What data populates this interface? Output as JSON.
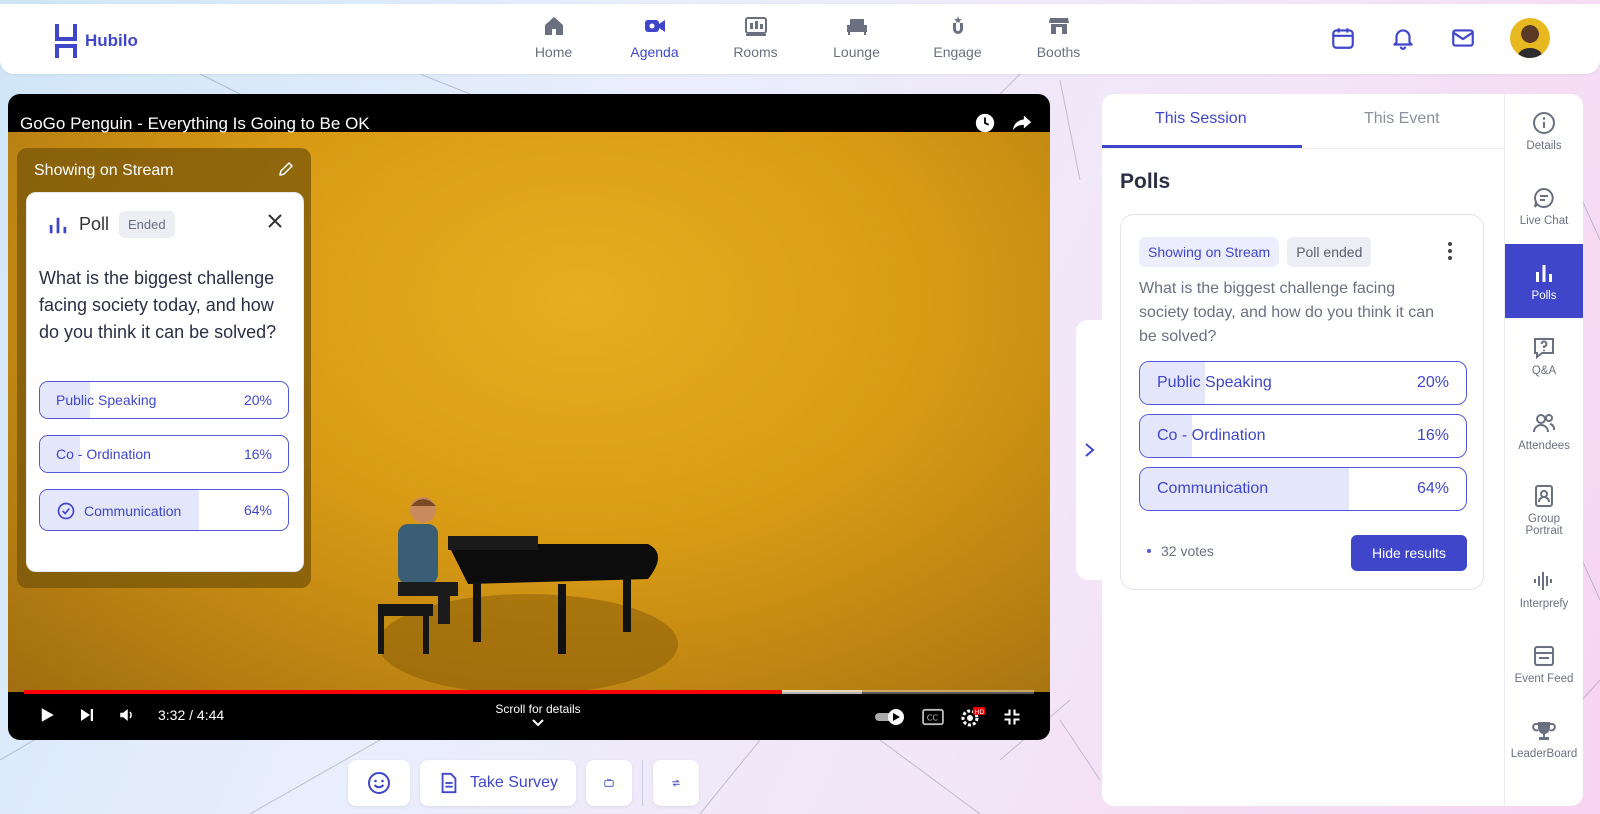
{
  "brand": {
    "name": "Hubilo",
    "color": "#3f46c9"
  },
  "nav": {
    "items": [
      {
        "label": "Home",
        "icon": "home-icon",
        "active": false
      },
      {
        "label": "Agenda",
        "icon": "video-camera-icon",
        "active": true
      },
      {
        "label": "Rooms",
        "icon": "rooms-icon",
        "active": false
      },
      {
        "label": "Lounge",
        "icon": "lounge-sofa-icon",
        "active": false
      },
      {
        "label": "Engage",
        "icon": "engage-icon",
        "active": false
      },
      {
        "label": "Booths",
        "icon": "booth-icon",
        "active": false
      }
    ],
    "right_icons": [
      "calendar-icon",
      "bell-icon",
      "mail-icon",
      "avatar"
    ]
  },
  "video": {
    "title": "GoGo Penguin - Everything Is Going to Be OK",
    "time": "3:32 / 4:44",
    "played_fraction": 0.75,
    "buffered_fraction": 0.83,
    "scroll_hint": "Scroll for details"
  },
  "stream_overlay": {
    "header": "Showing on Stream",
    "poll_label": "Poll",
    "status": "Ended",
    "question": "What is the biggest challenge facing society today, and how do you think it can be solved?",
    "options": [
      {
        "label": "Public Speaking",
        "percent": "20%",
        "value": 20,
        "selected": false
      },
      {
        "label": "Co - Ordination",
        "percent": "16%",
        "value": 16,
        "selected": false
      },
      {
        "label": "Communication",
        "percent": "64%",
        "value": 64,
        "selected": true
      }
    ]
  },
  "bottombar": {
    "survey_label": "Take Survey"
  },
  "panel": {
    "tabs": [
      "This Session",
      "This Event"
    ],
    "title": "Polls",
    "poll": {
      "chip_stream": "Showing on Stream",
      "chip_status": "Poll ended",
      "question": "What is the biggest challenge facing society today, and how do you think it can be solved?",
      "options": [
        {
          "label": "Public Speaking",
          "percent": "20%",
          "value": 20
        },
        {
          "label": "Co - Ordination",
          "percent": "16%",
          "value": 16
        },
        {
          "label": "Communication",
          "percent": "64%",
          "value": 64
        }
      ],
      "votes": "32 votes",
      "hide_label": "Hide results"
    }
  },
  "rail": {
    "items": [
      {
        "label": "Details",
        "active": false
      },
      {
        "label": "Live Chat",
        "active": false
      },
      {
        "label": "Polls",
        "active": true
      },
      {
        "label": "Q&A",
        "active": false
      },
      {
        "label": "Attendees",
        "active": false
      },
      {
        "label": "Group Portrait",
        "active": false
      },
      {
        "label": "Interprefy",
        "active": false
      },
      {
        "label": "Event Feed",
        "active": false
      },
      {
        "label": "LeaderBoard",
        "active": false
      }
    ]
  }
}
